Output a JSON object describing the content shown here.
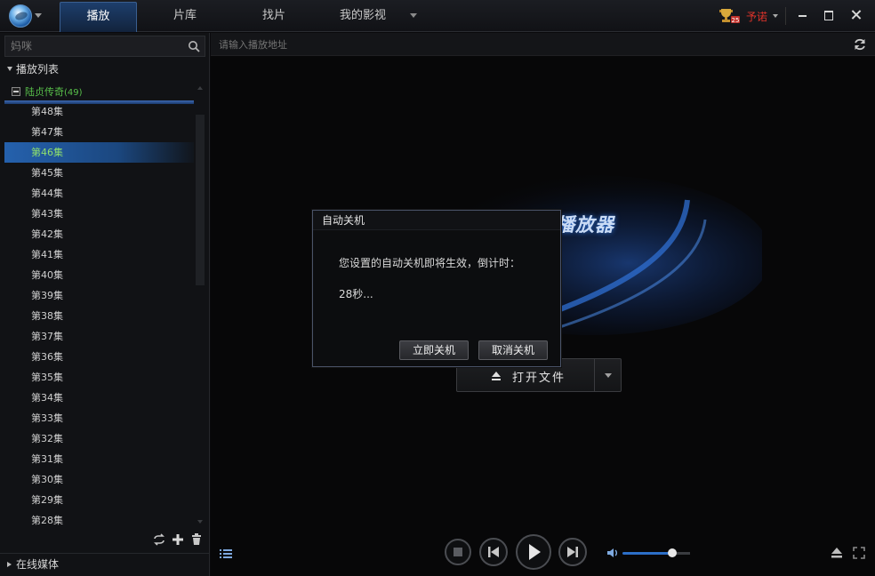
{
  "titlebar": {
    "tabs": [
      {
        "label": "播放",
        "active": true
      },
      {
        "label": "片库",
        "active": false
      },
      {
        "label": "找片",
        "active": false
      },
      {
        "label": "我的影视",
        "active": false
      }
    ],
    "username": "予诺",
    "user_color": "#e0332a"
  },
  "sidebar": {
    "search": {
      "placeholder": "妈咪"
    },
    "playlist_header": "播放列表",
    "group": {
      "name": "陆贞传奇",
      "count": "(49)"
    },
    "episodes": [
      "第48集",
      "第47集",
      "第46集",
      "第45集",
      "第44集",
      "第43集",
      "第42集",
      "第41集",
      "第40集",
      "第39集",
      "第38集",
      "第37集",
      "第36集",
      "第35集",
      "第34集",
      "第33集",
      "第32集",
      "第31集",
      "第30集",
      "第29集",
      "第28集"
    ],
    "active_episode": "第46集",
    "online_header": "在线媒体"
  },
  "main": {
    "address": {
      "placeholder": "请输入播放地址"
    },
    "brand": "迅雷看看播放器",
    "brand_sub": "",
    "open_file_label": "打开文件"
  },
  "dialog": {
    "title": "自动关机",
    "message": "您设置的自动关机即将生效，倒计时：",
    "countdown": "28秒...",
    "confirm_label": "立即关机",
    "cancel_label": "取消关机"
  },
  "player": {
    "volume_level": 0.74
  },
  "colors": {
    "accent": "#2c6fc8",
    "active_text": "#8fe06c",
    "group_text": "#58c04a"
  }
}
